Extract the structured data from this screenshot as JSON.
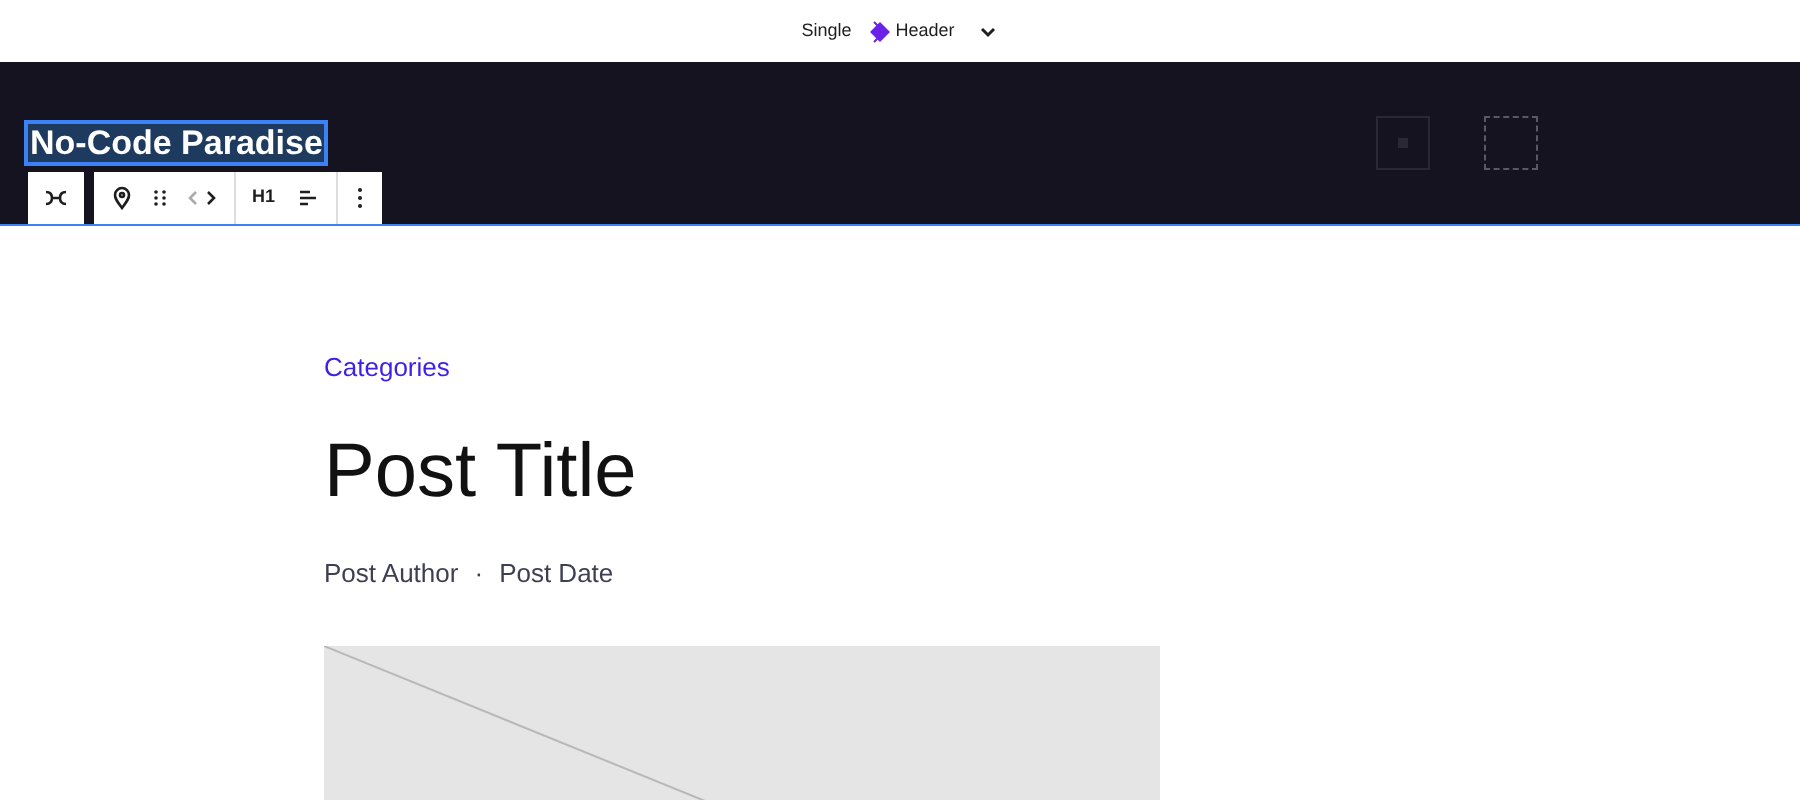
{
  "top_bar": {
    "template_type": "Single",
    "template_name": "Header"
  },
  "header": {
    "site_title": "No-Code Paradise",
    "site_title_selected": true
  },
  "block_toolbar": {
    "heading_level": "H1"
  },
  "post": {
    "categories": "Categories",
    "title": "Post Title",
    "author": "Post Author",
    "separator": "·",
    "date": "Post Date",
    "featured_image": {
      "kind": "placeholder"
    }
  }
}
